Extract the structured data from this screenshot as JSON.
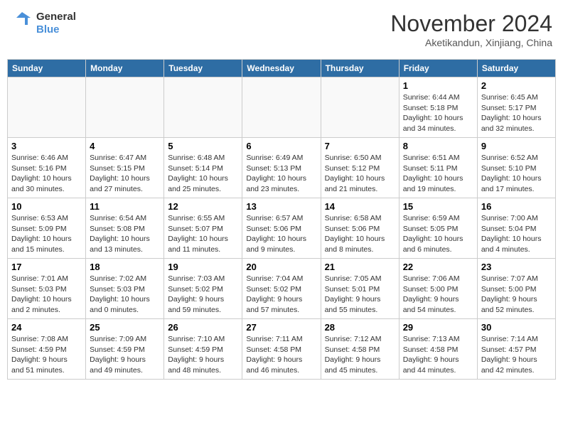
{
  "header": {
    "logo_line1": "General",
    "logo_line2": "Blue",
    "month": "November 2024",
    "location": "Aketikandun, Xinjiang, China"
  },
  "days_of_week": [
    "Sunday",
    "Monday",
    "Tuesday",
    "Wednesday",
    "Thursday",
    "Friday",
    "Saturday"
  ],
  "weeks": [
    [
      {
        "day": "",
        "info": ""
      },
      {
        "day": "",
        "info": ""
      },
      {
        "day": "",
        "info": ""
      },
      {
        "day": "",
        "info": ""
      },
      {
        "day": "",
        "info": ""
      },
      {
        "day": "1",
        "info": "Sunrise: 6:44 AM\nSunset: 5:18 PM\nDaylight: 10 hours and 34 minutes."
      },
      {
        "day": "2",
        "info": "Sunrise: 6:45 AM\nSunset: 5:17 PM\nDaylight: 10 hours and 32 minutes."
      }
    ],
    [
      {
        "day": "3",
        "info": "Sunrise: 6:46 AM\nSunset: 5:16 PM\nDaylight: 10 hours and 30 minutes."
      },
      {
        "day": "4",
        "info": "Sunrise: 6:47 AM\nSunset: 5:15 PM\nDaylight: 10 hours and 27 minutes."
      },
      {
        "day": "5",
        "info": "Sunrise: 6:48 AM\nSunset: 5:14 PM\nDaylight: 10 hours and 25 minutes."
      },
      {
        "day": "6",
        "info": "Sunrise: 6:49 AM\nSunset: 5:13 PM\nDaylight: 10 hours and 23 minutes."
      },
      {
        "day": "7",
        "info": "Sunrise: 6:50 AM\nSunset: 5:12 PM\nDaylight: 10 hours and 21 minutes."
      },
      {
        "day": "8",
        "info": "Sunrise: 6:51 AM\nSunset: 5:11 PM\nDaylight: 10 hours and 19 minutes."
      },
      {
        "day": "9",
        "info": "Sunrise: 6:52 AM\nSunset: 5:10 PM\nDaylight: 10 hours and 17 minutes."
      }
    ],
    [
      {
        "day": "10",
        "info": "Sunrise: 6:53 AM\nSunset: 5:09 PM\nDaylight: 10 hours and 15 minutes."
      },
      {
        "day": "11",
        "info": "Sunrise: 6:54 AM\nSunset: 5:08 PM\nDaylight: 10 hours and 13 minutes."
      },
      {
        "day": "12",
        "info": "Sunrise: 6:55 AM\nSunset: 5:07 PM\nDaylight: 10 hours and 11 minutes."
      },
      {
        "day": "13",
        "info": "Sunrise: 6:57 AM\nSunset: 5:06 PM\nDaylight: 10 hours and 9 minutes."
      },
      {
        "day": "14",
        "info": "Sunrise: 6:58 AM\nSunset: 5:06 PM\nDaylight: 10 hours and 8 minutes."
      },
      {
        "day": "15",
        "info": "Sunrise: 6:59 AM\nSunset: 5:05 PM\nDaylight: 10 hours and 6 minutes."
      },
      {
        "day": "16",
        "info": "Sunrise: 7:00 AM\nSunset: 5:04 PM\nDaylight: 10 hours and 4 minutes."
      }
    ],
    [
      {
        "day": "17",
        "info": "Sunrise: 7:01 AM\nSunset: 5:03 PM\nDaylight: 10 hours and 2 minutes."
      },
      {
        "day": "18",
        "info": "Sunrise: 7:02 AM\nSunset: 5:03 PM\nDaylight: 10 hours and 0 minutes."
      },
      {
        "day": "19",
        "info": "Sunrise: 7:03 AM\nSunset: 5:02 PM\nDaylight: 9 hours and 59 minutes."
      },
      {
        "day": "20",
        "info": "Sunrise: 7:04 AM\nSunset: 5:02 PM\nDaylight: 9 hours and 57 minutes."
      },
      {
        "day": "21",
        "info": "Sunrise: 7:05 AM\nSunset: 5:01 PM\nDaylight: 9 hours and 55 minutes."
      },
      {
        "day": "22",
        "info": "Sunrise: 7:06 AM\nSunset: 5:00 PM\nDaylight: 9 hours and 54 minutes."
      },
      {
        "day": "23",
        "info": "Sunrise: 7:07 AM\nSunset: 5:00 PM\nDaylight: 9 hours and 52 minutes."
      }
    ],
    [
      {
        "day": "24",
        "info": "Sunrise: 7:08 AM\nSunset: 4:59 PM\nDaylight: 9 hours and 51 minutes."
      },
      {
        "day": "25",
        "info": "Sunrise: 7:09 AM\nSunset: 4:59 PM\nDaylight: 9 hours and 49 minutes."
      },
      {
        "day": "26",
        "info": "Sunrise: 7:10 AM\nSunset: 4:59 PM\nDaylight: 9 hours and 48 minutes."
      },
      {
        "day": "27",
        "info": "Sunrise: 7:11 AM\nSunset: 4:58 PM\nDaylight: 9 hours and 46 minutes."
      },
      {
        "day": "28",
        "info": "Sunrise: 7:12 AM\nSunset: 4:58 PM\nDaylight: 9 hours and 45 minutes."
      },
      {
        "day": "29",
        "info": "Sunrise: 7:13 AM\nSunset: 4:58 PM\nDaylight: 9 hours and 44 minutes."
      },
      {
        "day": "30",
        "info": "Sunrise: 7:14 AM\nSunset: 4:57 PM\nDaylight: 9 hours and 42 minutes."
      }
    ]
  ]
}
